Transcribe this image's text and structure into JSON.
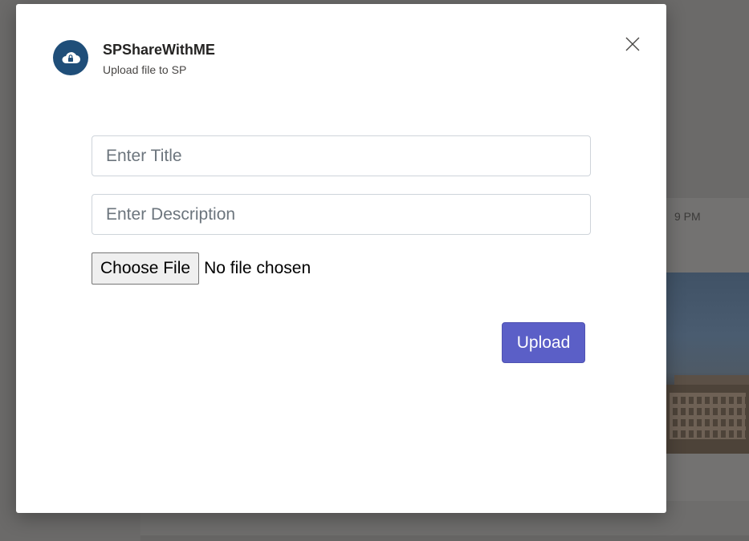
{
  "background": {
    "timestamp_fragment": "9 PM"
  },
  "dialog": {
    "app_name": "SPShareWithME",
    "subtitle": "Upload file to SP",
    "app_icon": "cloud-lock-icon",
    "close_icon": "close-icon"
  },
  "form": {
    "title_placeholder": "Enter Title",
    "title_value": "",
    "description_placeholder": "Enter Description",
    "description_value": "",
    "choose_file_label": "Choose File",
    "file_status": "No file chosen",
    "upload_label": "Upload"
  },
  "colors": {
    "app_icon_bg": "#1f4e79",
    "primary_button": "#5b5fc7",
    "overlay": "#6b6a69"
  }
}
